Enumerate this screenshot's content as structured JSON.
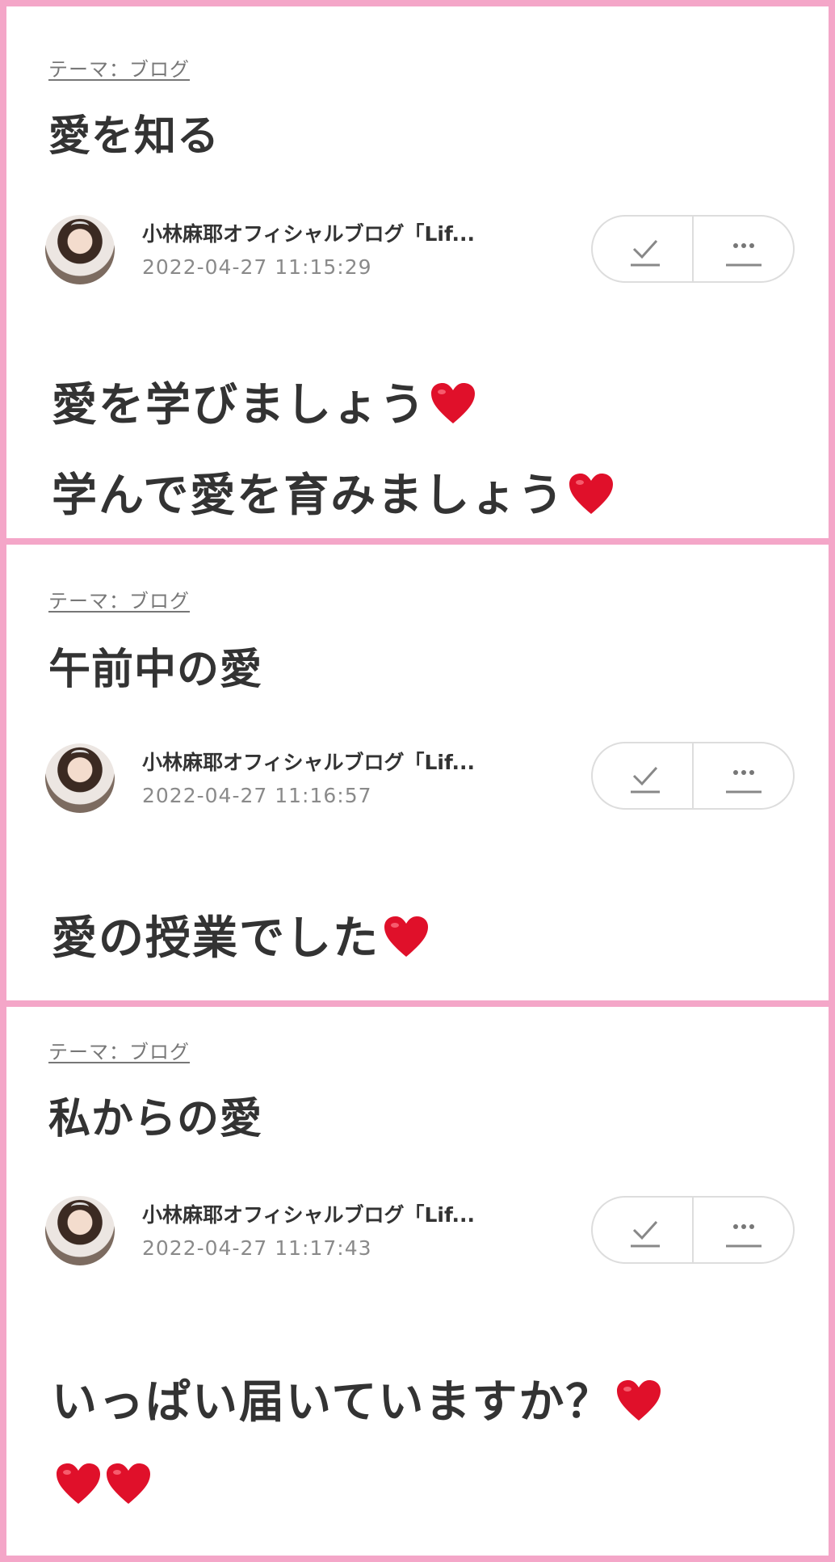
{
  "posts": [
    {
      "theme": "テーマ：ブログ",
      "title": "愛を知る",
      "author": "小林麻耶オフィシャルブログ「Lif...",
      "datetime": "2022-04-27 11:15:29",
      "body": [
        "愛を学びましょう",
        "学んで愛を育みましょう"
      ]
    },
    {
      "theme": "テーマ：ブログ",
      "title": "午前中の愛",
      "author": "小林麻耶オフィシャルブログ「Lif...",
      "datetime": "2022-04-27 11:16:57",
      "body": [
        "愛の授業でした"
      ]
    },
    {
      "theme": "テーマ：ブログ",
      "title": "私からの愛",
      "author": "小林麻耶オフィシャルブログ「Lif...",
      "datetime": "2022-04-27 11:17:43",
      "body": [
        "いっぱい届いていますか？",
        ""
      ]
    }
  ],
  "icons": {
    "check": "check-icon",
    "more": "more-icon",
    "heart": "heart-icon"
  },
  "colors": {
    "frame_pink": "#f4a6c8",
    "heart_red": "#e0102a",
    "text_dark": "#333333",
    "text_gray": "#8a8a8a"
  }
}
